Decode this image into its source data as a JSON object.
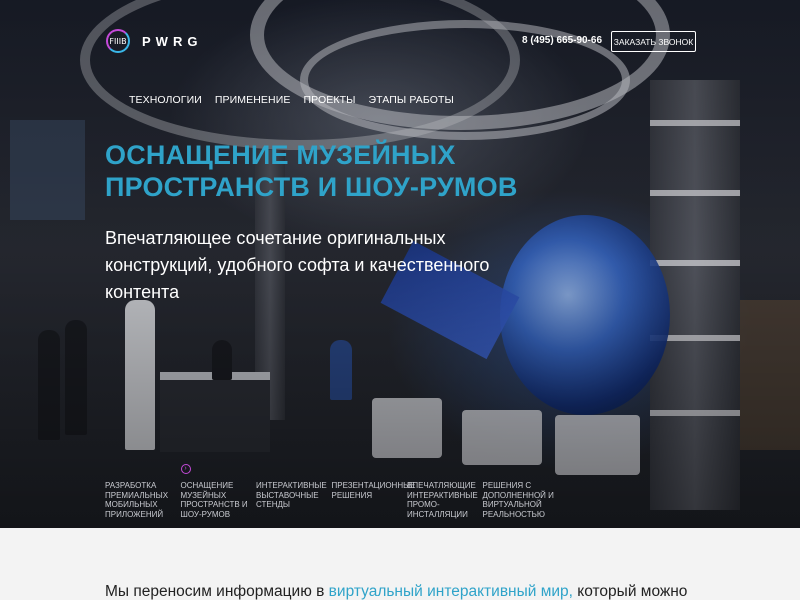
{
  "header": {
    "logo_mark": "FIIIB",
    "logo_text": "PWRG",
    "phone": "8 (495) 665-90-66",
    "callback_label": "ЗАКАЗАТЬ ЗВОНОК"
  },
  "nav": {
    "items": [
      "ТЕХНОЛОГИИ",
      "ПРИМЕНЕНИЕ",
      "ПРОЕКТЫ",
      "ЭТАПЫ РАБОТЫ"
    ]
  },
  "hero": {
    "headline": "ОСНАЩЕНИЕ МУЗЕЙНЫХ ПРОСТРАНСТВ И ШОУ-РУМОВ",
    "subheadline": "Впечатляющее сочетание оригинальных конструкций, удобного софта и качественного контента",
    "services": [
      "РАЗРАБОТКА ПРЕМИАЛЬНЫХ МОБИЛЬНЫХ ПРИЛОЖЕНИЙ",
      "ОСНАЩЕНИЕ МУЗЕЙНЫХ ПРОСТРАНСТВ И ШОУ-РУМОВ",
      "ИНТЕРАКТИВНЫЕ ВЫСТАВОЧНЫЕ СТЕНДЫ",
      "ПРЕЗЕНТАЦИОННЫЕ РЕШЕНИЯ",
      "ВПЕЧАТЛЯЮЩИЕ ИНТЕРАКТИВНЫЕ ПРОМО-ИНСТАЛЛЯЦИИ",
      "РЕШЕНИЯ С ДОПОЛНЕННОЙ И ВИРТУАЛЬНОЙ РЕАЛЬНОСТЬЮ"
    ],
    "active_service_index": 1,
    "active_icon": "arrow-right-circle-icon"
  },
  "intro": {
    "text_before": "Мы переносим информацию в ",
    "highlight": "виртуальный интерактивный мир,",
    "text_after": " который можно"
  },
  "colors": {
    "accent": "#2fa3c9",
    "logo_magenta": "#c44ad9",
    "page_bg": "#f3f3f3"
  }
}
